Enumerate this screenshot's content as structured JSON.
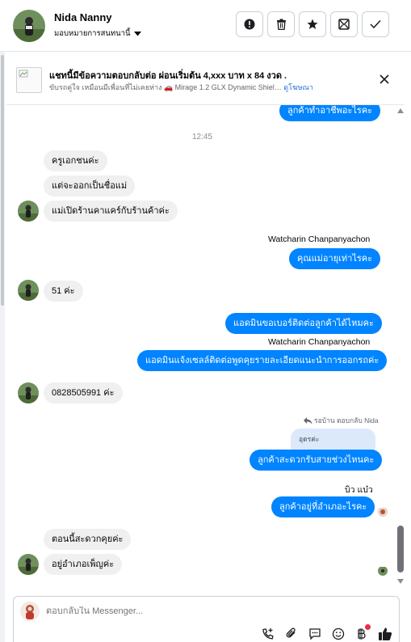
{
  "header": {
    "name": "Nida Nanny",
    "assign_label": "มอบหมายการสนทนานี้",
    "buttons": [
      {
        "icon": "alert-icon"
      },
      {
        "icon": "trash-icon"
      },
      {
        "icon": "star-icon"
      },
      {
        "icon": "mark-unread-icon"
      },
      {
        "icon": "check-icon"
      }
    ]
  },
  "ad": {
    "title": "แชทนี้มีข้อความตอบกลับต่อ ผ่อนเริ่มต้น 4,xxx บาท x 84 งวด .",
    "subtitle": "ขับรถคู่ใจ เหมือนมีเพื่อนที่ไม่เคยห่าง 🚗 Mirage 1.2 GLX Dynamic Shiel…",
    "link": "ดูโฆษณา"
  },
  "chat": {
    "timestamp": "12:45",
    "messages": [
      {
        "text": "ลูกค้าทำอาชีพอะไรคะ",
        "dir": "out"
      },
      {
        "text": "ครูเอกชนค่ะ",
        "dir": "in"
      },
      {
        "text": "แต่จะออกเป็นชื่อแม่",
        "dir": "in"
      },
      {
        "text": "แม่เปิดร้านคาแคร์กับร้านค้าค่ะ",
        "dir": "in"
      },
      {
        "sender": "Watcharin Chanpanyachon"
      },
      {
        "text": "คุณแม่อายุเท่าไรคะ",
        "dir": "out"
      },
      {
        "text": "51 ค่ะ",
        "dir": "in"
      },
      {
        "text": "แอดมินขอเบอร์ติดต่อลูกค้าได้ไหมคะ",
        "dir": "out"
      },
      {
        "sender": "Watcharin Chanpanyachon"
      },
      {
        "text": "แอดมินแจ้งเซลล์ติดต่อพูดคุยรายละเอียดแนะนำการออกรถค่ะ",
        "dir": "out"
      },
      {
        "text": "0828505991 ค่ะ",
        "dir": "in"
      },
      {
        "reply_header": "รอบ้าน ตอบกลับ Nida",
        "quote": "อุดรค่ะ"
      },
      {
        "text": "ลูกค้าสะดวกรับสายช่วงไหนคะ",
        "dir": "out"
      },
      {
        "sender": "บิว แบ๋ว"
      },
      {
        "text": "ลูกค้าอยู่ที่อำเภอะไรคะ",
        "dir": "out"
      },
      {
        "text": "ตอนนี้สะดวกคุยค่ะ",
        "dir": "in"
      },
      {
        "text": "อยู่อำเภอเพ็ญค่ะ",
        "dir": "in"
      }
    ]
  },
  "composer": {
    "placeholder": "ตอบกลับใน Messenger...",
    "tools": [
      "call-add-icon",
      "attachment-icon",
      "saved-reply-icon",
      "emoji-icon",
      "payment-icon",
      "like-icon"
    ]
  },
  "colors": {
    "outgoing": "#0084ff",
    "incoming": "#f0f0f0",
    "link": "#216fdb"
  }
}
